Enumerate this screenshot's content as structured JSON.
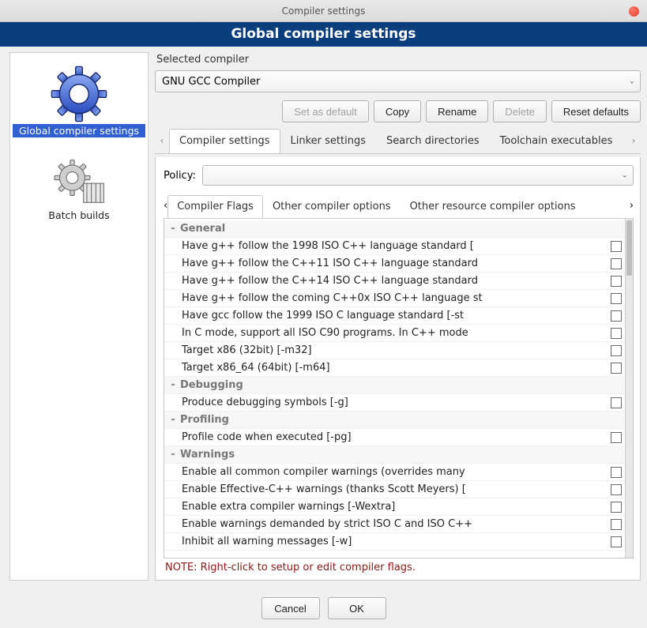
{
  "window": {
    "title": "Compiler settings",
    "banner": "Global compiler settings"
  },
  "sidebar": {
    "items": [
      {
        "label": "Global compiler settings"
      },
      {
        "label": "Batch builds"
      }
    ]
  },
  "selected_compiler": {
    "label": "Selected compiler",
    "value": "GNU GCC Compiler"
  },
  "compiler_buttons": {
    "set_default": "Set as default",
    "copy": "Copy",
    "rename": "Rename",
    "delete": "Delete",
    "reset": "Reset defaults"
  },
  "tabs": {
    "items": [
      "Compiler settings",
      "Linker settings",
      "Search directories",
      "Toolchain executables"
    ],
    "active": 0
  },
  "policy": {
    "label": "Policy:",
    "value": ""
  },
  "subtabs": {
    "items": [
      "Compiler Flags",
      "Other compiler options",
      "Other resource compiler options"
    ],
    "active": 0
  },
  "flags": {
    "categories": [
      {
        "name": "General",
        "items": [
          "Have g++ follow the 1998 ISO C++ language standard  [",
          "Have g++ follow the C++11 ISO C++ language standard",
          "Have g++ follow the C++14 ISO C++ language standard",
          "Have g++ follow the coming C++0x ISO C++ language st",
          "Have gcc follow the 1999 ISO C language standard  [-st",
          "In C mode, support all ISO C90 programs. In C++ mode",
          "Target x86 (32bit)  [-m32]",
          "Target x86_64 (64bit)  [-m64]"
        ]
      },
      {
        "name": "Debugging",
        "items": [
          "Produce debugging symbols  [-g]"
        ]
      },
      {
        "name": "Profiling",
        "items": [
          "Profile code when executed  [-pg]"
        ]
      },
      {
        "name": "Warnings",
        "items": [
          "Enable all common compiler warnings (overrides many",
          "Enable Effective-C++ warnings (thanks Scott Meyers)  [",
          "Enable extra compiler warnings  [-Wextra]",
          "Enable warnings demanded by strict ISO C and ISO C++",
          "Inhibit all warning messages  [-w]"
        ]
      }
    ],
    "note": "NOTE: Right-click to setup or edit compiler flags."
  },
  "footer": {
    "cancel": "Cancel",
    "ok": "OK"
  }
}
